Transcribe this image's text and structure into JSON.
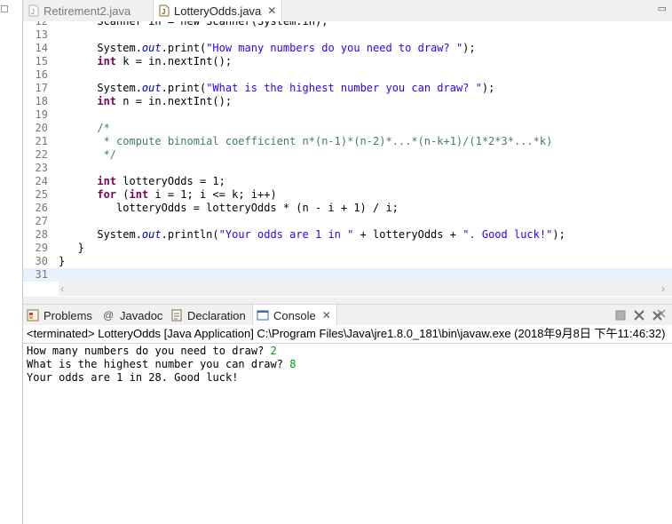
{
  "editor": {
    "tabs": [
      {
        "label": "Retirement2.java",
        "active": false
      },
      {
        "label": "LotteryOdds.java",
        "active": true
      }
    ],
    "current_line": 31,
    "lines": [
      {
        "n": "12",
        "tokens": [
          {
            "t": "      Scanner in = new Scanner(System.in);",
            "c": ""
          }
        ]
      },
      {
        "n": "13",
        "tokens": []
      },
      {
        "n": "14",
        "tokens": [
          {
            "t": "      System.",
            "c": ""
          },
          {
            "t": "out",
            "c": "fld"
          },
          {
            "t": ".print(",
            "c": ""
          },
          {
            "t": "\"How many numbers do you need to draw? \"",
            "c": "str"
          },
          {
            "t": ");",
            "c": ""
          }
        ]
      },
      {
        "n": "15",
        "tokens": [
          {
            "t": "      ",
            "c": ""
          },
          {
            "t": "int",
            "c": "kw"
          },
          {
            "t": " k = in.nextInt();",
            "c": ""
          }
        ]
      },
      {
        "n": "16",
        "tokens": []
      },
      {
        "n": "17",
        "tokens": [
          {
            "t": "      System.",
            "c": ""
          },
          {
            "t": "out",
            "c": "fld"
          },
          {
            "t": ".print(",
            "c": ""
          },
          {
            "t": "\"What is the highest number you can draw? \"",
            "c": "str"
          },
          {
            "t": ");",
            "c": ""
          }
        ]
      },
      {
        "n": "18",
        "tokens": [
          {
            "t": "      ",
            "c": ""
          },
          {
            "t": "int",
            "c": "kw"
          },
          {
            "t": " n = in.nextInt();",
            "c": ""
          }
        ]
      },
      {
        "n": "19",
        "tokens": []
      },
      {
        "n": "20",
        "tokens": [
          {
            "t": "      /*",
            "c": "cm"
          }
        ]
      },
      {
        "n": "21",
        "tokens": [
          {
            "t": "       * compute binomial coefficient n*(n-1)*(n-2)*...*(n-k+1)/(1*2*3*...*k)",
            "c": "cm"
          }
        ]
      },
      {
        "n": "22",
        "tokens": [
          {
            "t": "       */",
            "c": "cm"
          }
        ]
      },
      {
        "n": "23",
        "tokens": []
      },
      {
        "n": "24",
        "tokens": [
          {
            "t": "      ",
            "c": ""
          },
          {
            "t": "int",
            "c": "kw"
          },
          {
            "t": " lotteryOdds = 1;",
            "c": ""
          }
        ]
      },
      {
        "n": "25",
        "tokens": [
          {
            "t": "      ",
            "c": ""
          },
          {
            "t": "for",
            "c": "kw"
          },
          {
            "t": " (",
            "c": ""
          },
          {
            "t": "int",
            "c": "kw"
          },
          {
            "t": " i = 1; i <= k; i++)",
            "c": ""
          }
        ]
      },
      {
        "n": "26",
        "tokens": [
          {
            "t": "         lotteryOdds = lotteryOdds * (n - i + 1) / i;",
            "c": ""
          }
        ]
      },
      {
        "n": "27",
        "tokens": []
      },
      {
        "n": "28",
        "tokens": [
          {
            "t": "      System.",
            "c": ""
          },
          {
            "t": "out",
            "c": "fld"
          },
          {
            "t": ".println(",
            "c": ""
          },
          {
            "t": "\"Your odds are 1 in \"",
            "c": "str"
          },
          {
            "t": " + lotteryOdds + ",
            "c": ""
          },
          {
            "t": "\". Good luck!\"",
            "c": "str"
          },
          {
            "t": ");",
            "c": ""
          }
        ]
      },
      {
        "n": "29",
        "tokens": [
          {
            "t": "   }",
            "c": ""
          }
        ]
      },
      {
        "n": "30",
        "tokens": [
          {
            "t": "}",
            "c": ""
          }
        ]
      },
      {
        "n": "31",
        "tokens": []
      }
    ]
  },
  "views": {
    "tabs": [
      {
        "label": "Problems",
        "icon": "problems-icon"
      },
      {
        "label": "Javadoc",
        "icon": "javadoc-icon"
      },
      {
        "label": "Declaration",
        "icon": "declaration-icon"
      },
      {
        "label": "Console",
        "icon": "console-icon",
        "active": true
      }
    ],
    "toolbar": [
      "terminate-icon",
      "remove-launches-icon"
    ]
  },
  "console": {
    "status": "<terminated> LotteryOdds [Java Application] C:\\Program Files\\Java\\jre1.8.0_181\\bin\\javaw.exe (2018年9月8日 下午11:46:32)",
    "output": [
      {
        "text": "How many numbers do you need to draw? ",
        "input": "2"
      },
      {
        "text": "What is the highest number you can draw? ",
        "input": "8"
      },
      {
        "text": "Your odds are 1 in 28. Good luck!",
        "input": ""
      }
    ]
  },
  "colors": {
    "keyword": "#7f0055",
    "string": "#2a00ff",
    "comment": "#3f7f5f",
    "field": "#0000c0",
    "user_input": "#00a000",
    "current_line": "#e8f2fe"
  }
}
